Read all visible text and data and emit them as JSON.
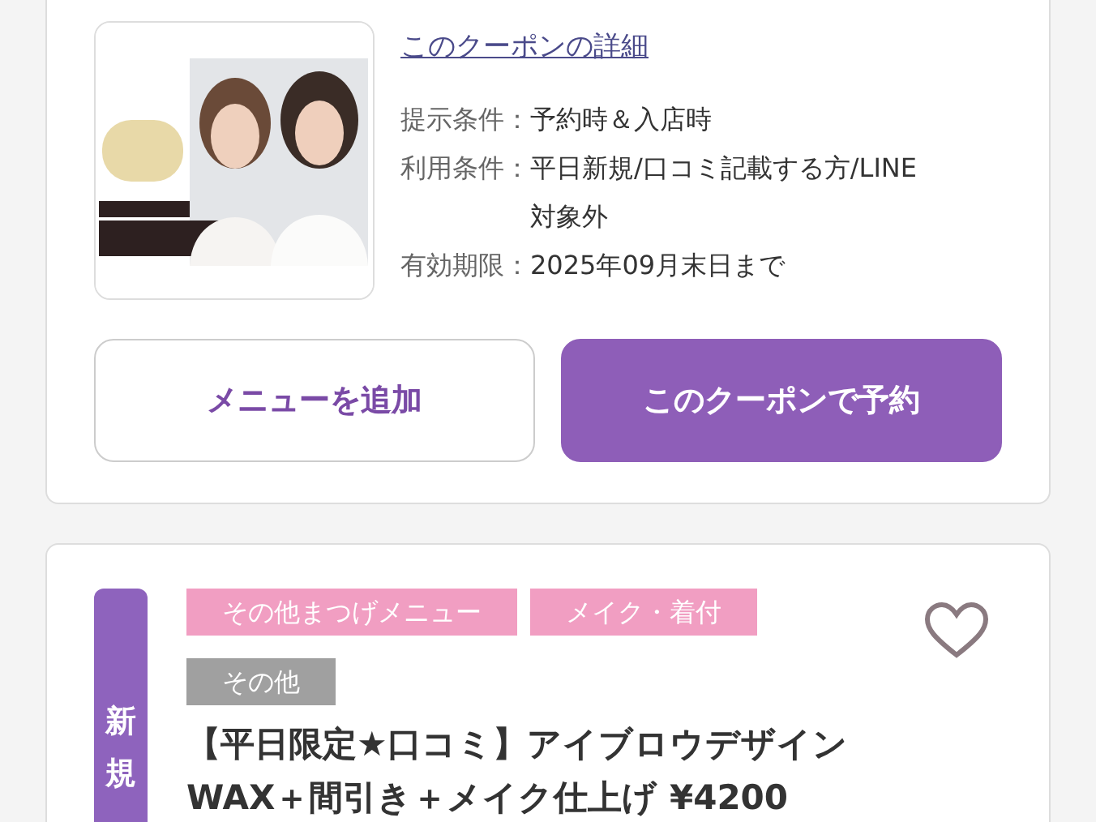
{
  "coupon_card": {
    "detail_link": "このクーポンの詳細",
    "conditions": [
      {
        "label": "提示条件",
        "separator": "：",
        "value": "予約時＆入店時"
      },
      {
        "label": "利用条件",
        "separator": "：",
        "value": "平日新規/口コミ記載する方/LINE対象外"
      },
      {
        "label": "有効期限",
        "separator": "：",
        "value": "2025年09月末日まで"
      }
    ],
    "buttons": [
      {
        "label": "メニューを追加",
        "kind": "outline"
      },
      {
        "label": "このクーポンで予約",
        "kind": "primary"
      }
    ]
  },
  "menu_card": {
    "badge": "新規",
    "tags": [
      {
        "label": "その他まつげメニュー",
        "color": "#f19ec2"
      },
      {
        "label": "メイク・着付",
        "color": "#f19ec2"
      },
      {
        "label": "その他",
        "color": "#a0a0a0"
      }
    ],
    "favorited": false,
    "title": "【平日限定★口コミ】アイブロウデザインWAX＋間引き＋メイク仕上げ ¥4200"
  }
}
